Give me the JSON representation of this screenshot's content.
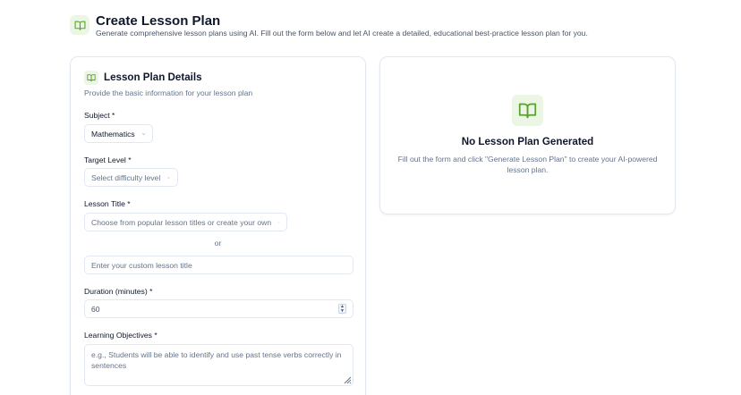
{
  "colors": {
    "accent": "#5aa02c",
    "icon_bg": "#ecf6e4",
    "border": "#e2e8f0",
    "muted_text": "#64748b"
  },
  "header": {
    "icon": "book-open-icon",
    "title": "Create Lesson Plan",
    "subtitle": "Generate comprehensive lesson plans using AI. Fill out the form below and let AI create a detailed, educational best-practice lesson plan for you."
  },
  "form": {
    "icon": "book-open-icon",
    "title": "Lesson Plan Details",
    "description": "Provide the basic information for your lesson plan",
    "subject": {
      "label": "Subject *",
      "value": "Mathematics"
    },
    "target_level": {
      "label": "Target Level *",
      "placeholder": "Select difficulty level"
    },
    "lesson_title": {
      "label": "Lesson Title *",
      "placeholder": "Choose from popular lesson titles or create your own",
      "or_text": "or",
      "custom_placeholder": "Enter your custom lesson title"
    },
    "duration": {
      "label": "Duration (minutes) *",
      "value": "60"
    },
    "objectives": {
      "label": "Learning Objectives *",
      "placeholder": "e.g., Students will be able to identify and use past tense verbs correctly in sentences"
    }
  },
  "empty_state": {
    "icon": "book-open-icon",
    "title": "No Lesson Plan Generated",
    "description": "Fill out the form and click \"Generate Lesson Plan\" to create your AI-powered lesson plan."
  }
}
